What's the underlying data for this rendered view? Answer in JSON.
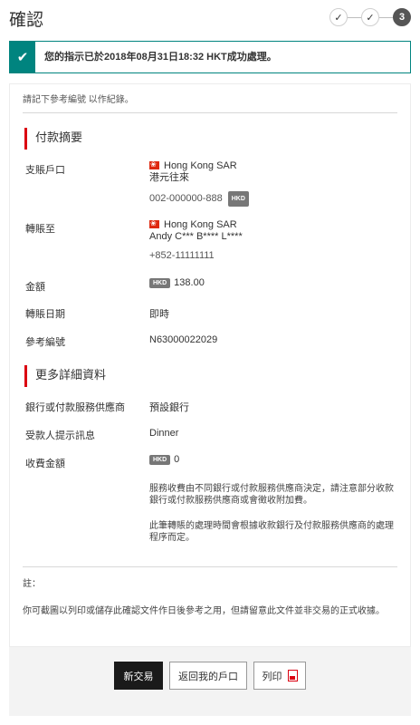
{
  "header": {
    "title": "確認",
    "steps": [
      "✓",
      "✓",
      "3"
    ]
  },
  "banner": {
    "message": "您的指示已於2018年08月31日18:32 HKT成功處理。"
  },
  "reference_note": "請記下參考編號 以作紀錄。",
  "payment_summary": {
    "title": "付款摘要",
    "from_label": "支賬戶口",
    "from_region": "Hong Kong SAR",
    "from_account_type": "港元往來",
    "from_account_number": "002-000000-888",
    "from_currency": "HKD",
    "to_label": "轉賬至",
    "to_region": "Hong Kong SAR",
    "to_name": "Andy C*** B**** L****",
    "to_phone": "+852-11111111",
    "amount_label": "金額",
    "amount_currency": "HKD",
    "amount_value": "138.00",
    "date_label": "轉賬日期",
    "date_value": "即時",
    "ref_label": "參考編號",
    "ref_value": "N63000022029"
  },
  "more_details": {
    "title": "更多詳細資料",
    "bank_label": "銀行或付款服務供應商",
    "bank_value": "預設銀行",
    "payee_msg_label": "受款人提示訊息",
    "payee_msg_value": "Dinner",
    "fee_label": "收費金額",
    "fee_currency": "HKD",
    "fee_value": "0",
    "fee_note_1": "服務收費由不同銀行或付款服務供應商決定，請注意部分收款銀行或付款服務供應商或會徵收附加費。",
    "fee_note_2": "此筆轉賬的處理時間會根據收款銀行及付款服務供應商的處理程序而定。"
  },
  "footnote_label": "註：",
  "footnote_text": "你可截圖以列印或儲存此確認文件作日後參考之用，但請留意此文件並非交易的正式收據。",
  "actions": {
    "new_transaction": "新交易",
    "back_to_account": "返回我的戶口",
    "print": "列印"
  },
  "colors": {
    "success": "#00847f",
    "accent": "#db0011",
    "primary_button": "#1a1a1a"
  }
}
